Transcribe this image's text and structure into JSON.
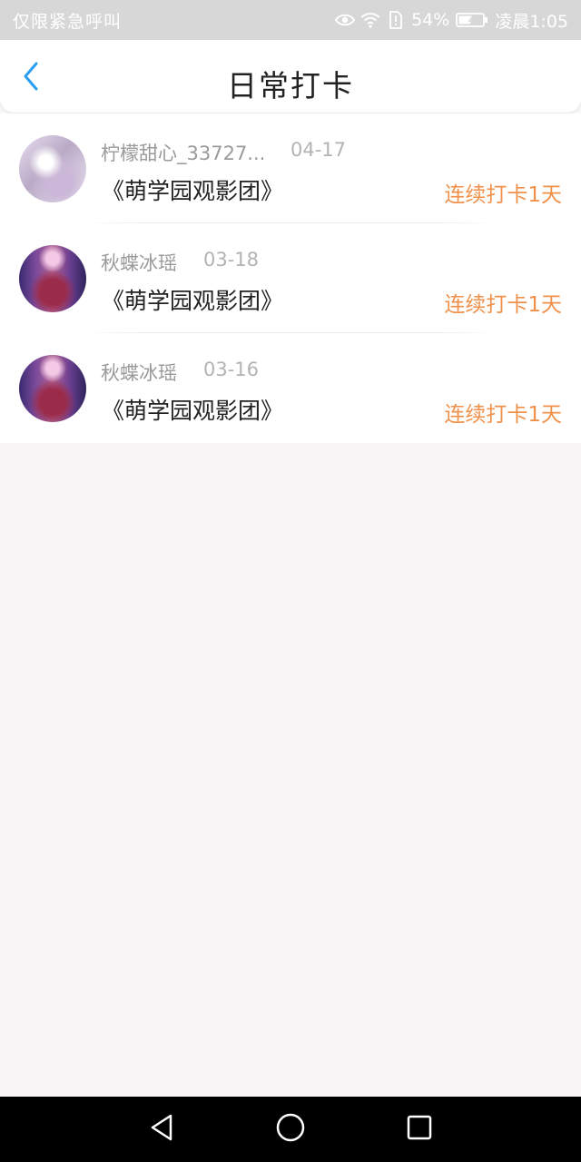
{
  "status_bar": {
    "left_text": "仅限紧急呼叫",
    "battery": "54%",
    "time": "凌晨1:05",
    "icons": [
      "eye-icon",
      "wifi-icon",
      "sim-alert-icon",
      "battery-icon"
    ]
  },
  "header": {
    "title": "日常打卡",
    "back_icon": "chevron-left-icon",
    "accent_color": "#2b9ef0"
  },
  "checkins": [
    {
      "username": "柠檬甜心_33727...",
      "date": "04-17",
      "group": "《萌学园观影团》",
      "streak": "连续打卡1天"
    },
    {
      "username": "秋蝶冰瑶",
      "date": "03-18",
      "group": "《萌学园观影团》",
      "streak": "连续打卡1天"
    },
    {
      "username": "秋蝶冰瑶",
      "date": "03-16",
      "group": "《萌学园观影团》",
      "streak": "连续打卡1天"
    }
  ],
  "colors": {
    "streak": "#f0914b",
    "background": "#f8f6f7"
  },
  "nav": {
    "icons": [
      "back-triangle-icon",
      "home-circle-icon",
      "recents-square-icon"
    ]
  }
}
